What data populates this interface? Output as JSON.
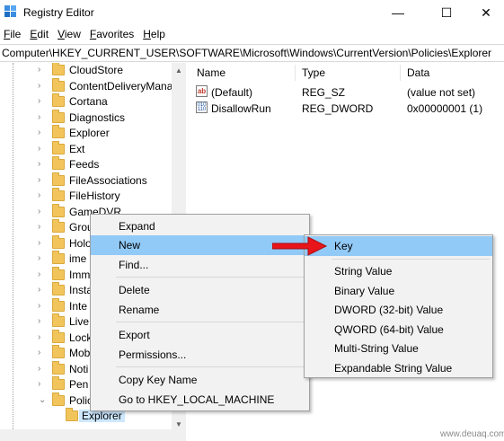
{
  "window": {
    "title": "Registry Editor",
    "app_icon": "registry-icon",
    "controls": {
      "minimize": "—",
      "maximize": "☐",
      "close": "✕"
    }
  },
  "menubar": {
    "items": [
      {
        "mnemonic": "F",
        "rest": "ile"
      },
      {
        "mnemonic": "E",
        "rest": "dit"
      },
      {
        "mnemonic": "V",
        "rest": "iew"
      },
      {
        "mnemonic": "F",
        "rest": "avorites"
      },
      {
        "mnemonic": "H",
        "rest": "elp"
      }
    ]
  },
  "address": {
    "path": "Computer\\HKEY_CURRENT_USER\\SOFTWARE\\Microsoft\\Windows\\CurrentVersion\\Policies\\Explorer"
  },
  "tree": {
    "items": [
      {
        "label": "CloudStore"
      },
      {
        "label": "ContentDeliveryMana"
      },
      {
        "label": "Cortana"
      },
      {
        "label": "Diagnostics"
      },
      {
        "label": "Explorer"
      },
      {
        "label": "Ext"
      },
      {
        "label": "Feeds"
      },
      {
        "label": "FileAssociations"
      },
      {
        "label": "FileHistory"
      },
      {
        "label": "GameDVR"
      },
      {
        "label": "Grou"
      },
      {
        "label": "Holo"
      },
      {
        "label": "ime"
      },
      {
        "label": "Imm"
      },
      {
        "label": "Insta"
      },
      {
        "label": "Inte"
      },
      {
        "label": "Live"
      },
      {
        "label": "Lock"
      },
      {
        "label": "Mob"
      },
      {
        "label": "Noti"
      },
      {
        "label": "Pen"
      },
      {
        "label": "Polic"
      }
    ],
    "selected_child": {
      "label": "Explorer"
    },
    "chevron_collapsed": "›",
    "chevron_expanded": "⌄"
  },
  "list": {
    "headers": {
      "name": "Name",
      "type": "Type",
      "data": "Data"
    },
    "rows": [
      {
        "icon": "ab",
        "icon_name": "string-value-icon",
        "name": "(Default)",
        "type": "REG_SZ",
        "data": "(value not set)"
      },
      {
        "icon": "010 110",
        "icon_name": "binary-value-icon",
        "name": "DisallowRun",
        "type": "REG_DWORD",
        "data": "0x00000001 (1)"
      }
    ]
  },
  "context_menu": {
    "items": [
      {
        "label": "Expand"
      },
      {
        "label": "New",
        "highlighted": true,
        "submenu_arrow": "›"
      },
      {
        "label": "Find..."
      },
      {
        "label": "Delete"
      },
      {
        "label": "Rename"
      },
      {
        "label": "Export"
      },
      {
        "label": "Permissions..."
      },
      {
        "label": "Copy Key Name"
      },
      {
        "label": "Go to HKEY_LOCAL_MACHINE"
      }
    ]
  },
  "submenu": {
    "items": [
      {
        "label": "Key",
        "highlighted": true
      },
      {
        "label": "String Value"
      },
      {
        "label": "Binary Value"
      },
      {
        "label": "DWORD (32-bit) Value"
      },
      {
        "label": "QWORD (64-bit) Value"
      },
      {
        "label": "Multi-String Value"
      },
      {
        "label": "Expandable String Value"
      }
    ]
  },
  "colors": {
    "highlight": "#91c9f7",
    "selection": "#cde8ff",
    "folder": "#f2c55c",
    "arrow": "#e8151b"
  },
  "watermark": "www.deuaq.com"
}
